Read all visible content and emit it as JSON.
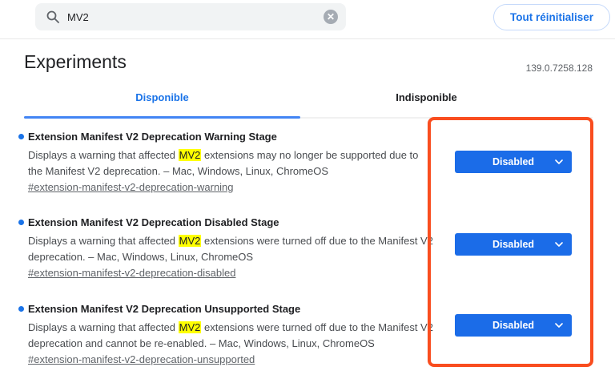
{
  "header": {
    "search": {
      "value": "MV2"
    },
    "reset_label": "Tout réinitialiser"
  },
  "page": {
    "title": "Experiments",
    "version": "139.0.7258.128"
  },
  "tabs": {
    "available": "Disponible",
    "unavailable": "Indisponible"
  },
  "experiments": [
    {
      "title": "Extension Manifest V2 Deprecation Warning Stage",
      "desc1_before": "Displays a warning that affected ",
      "desc1_mark": "MV2",
      "desc1_after": " extensions may no longer be supported due to",
      "desc2": "the Manifest V2 deprecation. – Mac, Windows, Linux, ChromeOS",
      "link": "#extension-manifest-v2-deprecation-warning",
      "select_value": "Disabled"
    },
    {
      "title": "Extension Manifest V2 Deprecation Disabled Stage",
      "desc1_before": "Displays a warning that affected ",
      "desc1_mark": "MV2",
      "desc1_after": " extensions were turned off due to the Manifest V2",
      "desc2": "deprecation. – Mac, Windows, Linux, ChromeOS",
      "link": "#extension-manifest-v2-deprecation-disabled",
      "select_value": "Disabled"
    },
    {
      "title": "Extension Manifest V2 Deprecation Unsupported Stage",
      "desc1_before": "Displays a warning that affected ",
      "desc1_mark": "MV2",
      "desc1_after": " extensions were turned off due to the Manifest V2",
      "desc2": "deprecation and cannot be re-enabled. – Mac, Windows, Linux, ChromeOS",
      "link": "#extension-manifest-v2-deprecation-unsupported",
      "select_value": "Disabled"
    }
  ],
  "icons": {
    "search": "magnifier-icon",
    "clear": "clear-circle-icon",
    "chevron": "chevron-down-icon"
  },
  "colors": {
    "accent_blue": "#1a73e8",
    "tab_underline_blue": "#4285f4",
    "select_blue": "#1b6ce8",
    "highlight_yellow": "#ffff00",
    "annotation_orange": "#f94d1f",
    "search_bg": "#f1f3f4",
    "text_primary": "#202124",
    "text_secondary": "#5f6368"
  }
}
